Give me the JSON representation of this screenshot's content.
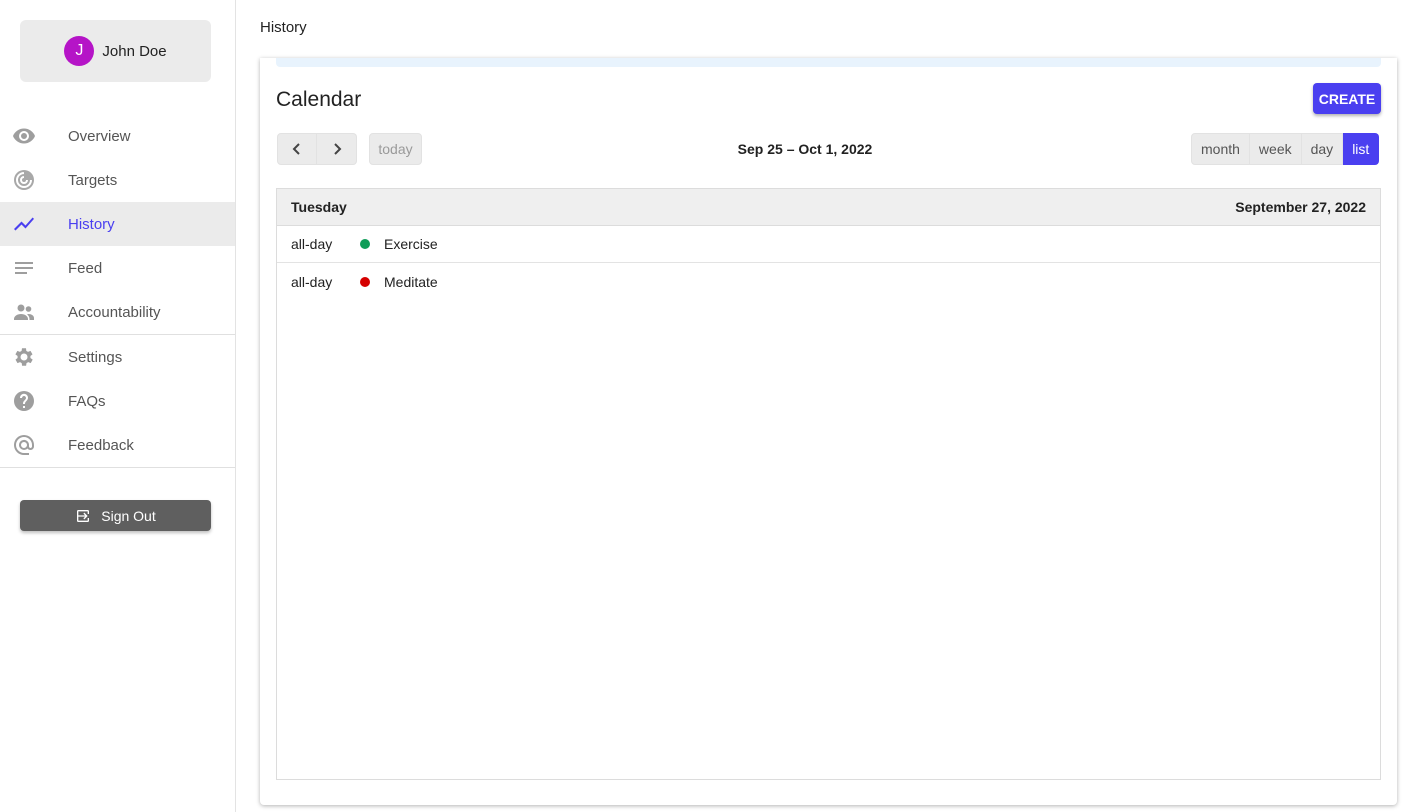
{
  "user": {
    "initial": "J",
    "name": "John Doe"
  },
  "sidebar": {
    "primary": [
      {
        "label": "Overview",
        "icon": "eye-icon",
        "active": false
      },
      {
        "label": "Targets",
        "icon": "target-icon",
        "active": false
      },
      {
        "label": "History",
        "icon": "trending-up-icon",
        "active": true
      },
      {
        "label": "Feed",
        "icon": "feed-lines-icon",
        "active": false
      },
      {
        "label": "Accountability",
        "icon": "people-icon",
        "active": false
      }
    ],
    "secondary": [
      {
        "label": "Settings",
        "icon": "gear-icon"
      },
      {
        "label": "FAQs",
        "icon": "help-icon"
      },
      {
        "label": "Feedback",
        "icon": "at-sign-icon"
      }
    ],
    "sign_out": "Sign Out"
  },
  "page": {
    "title": "History"
  },
  "calendar": {
    "title": "Calendar",
    "create_label": "CREATE",
    "today_label": "today",
    "range": "Sep 25 – Oct 1, 2022",
    "views": [
      "month",
      "week",
      "day",
      "list"
    ],
    "active_view": "list",
    "day_header": {
      "weekday": "Tuesday",
      "date": "September 27, 2022"
    },
    "events": [
      {
        "time": "all-day",
        "title": "Exercise",
        "color": "#0f9d58"
      },
      {
        "time": "all-day",
        "title": "Meditate",
        "color": "#d50000"
      }
    ]
  },
  "colors": {
    "accent": "#4a3ff0",
    "avatar": "#b514c7",
    "signout_bg": "#5f5f5f"
  }
}
